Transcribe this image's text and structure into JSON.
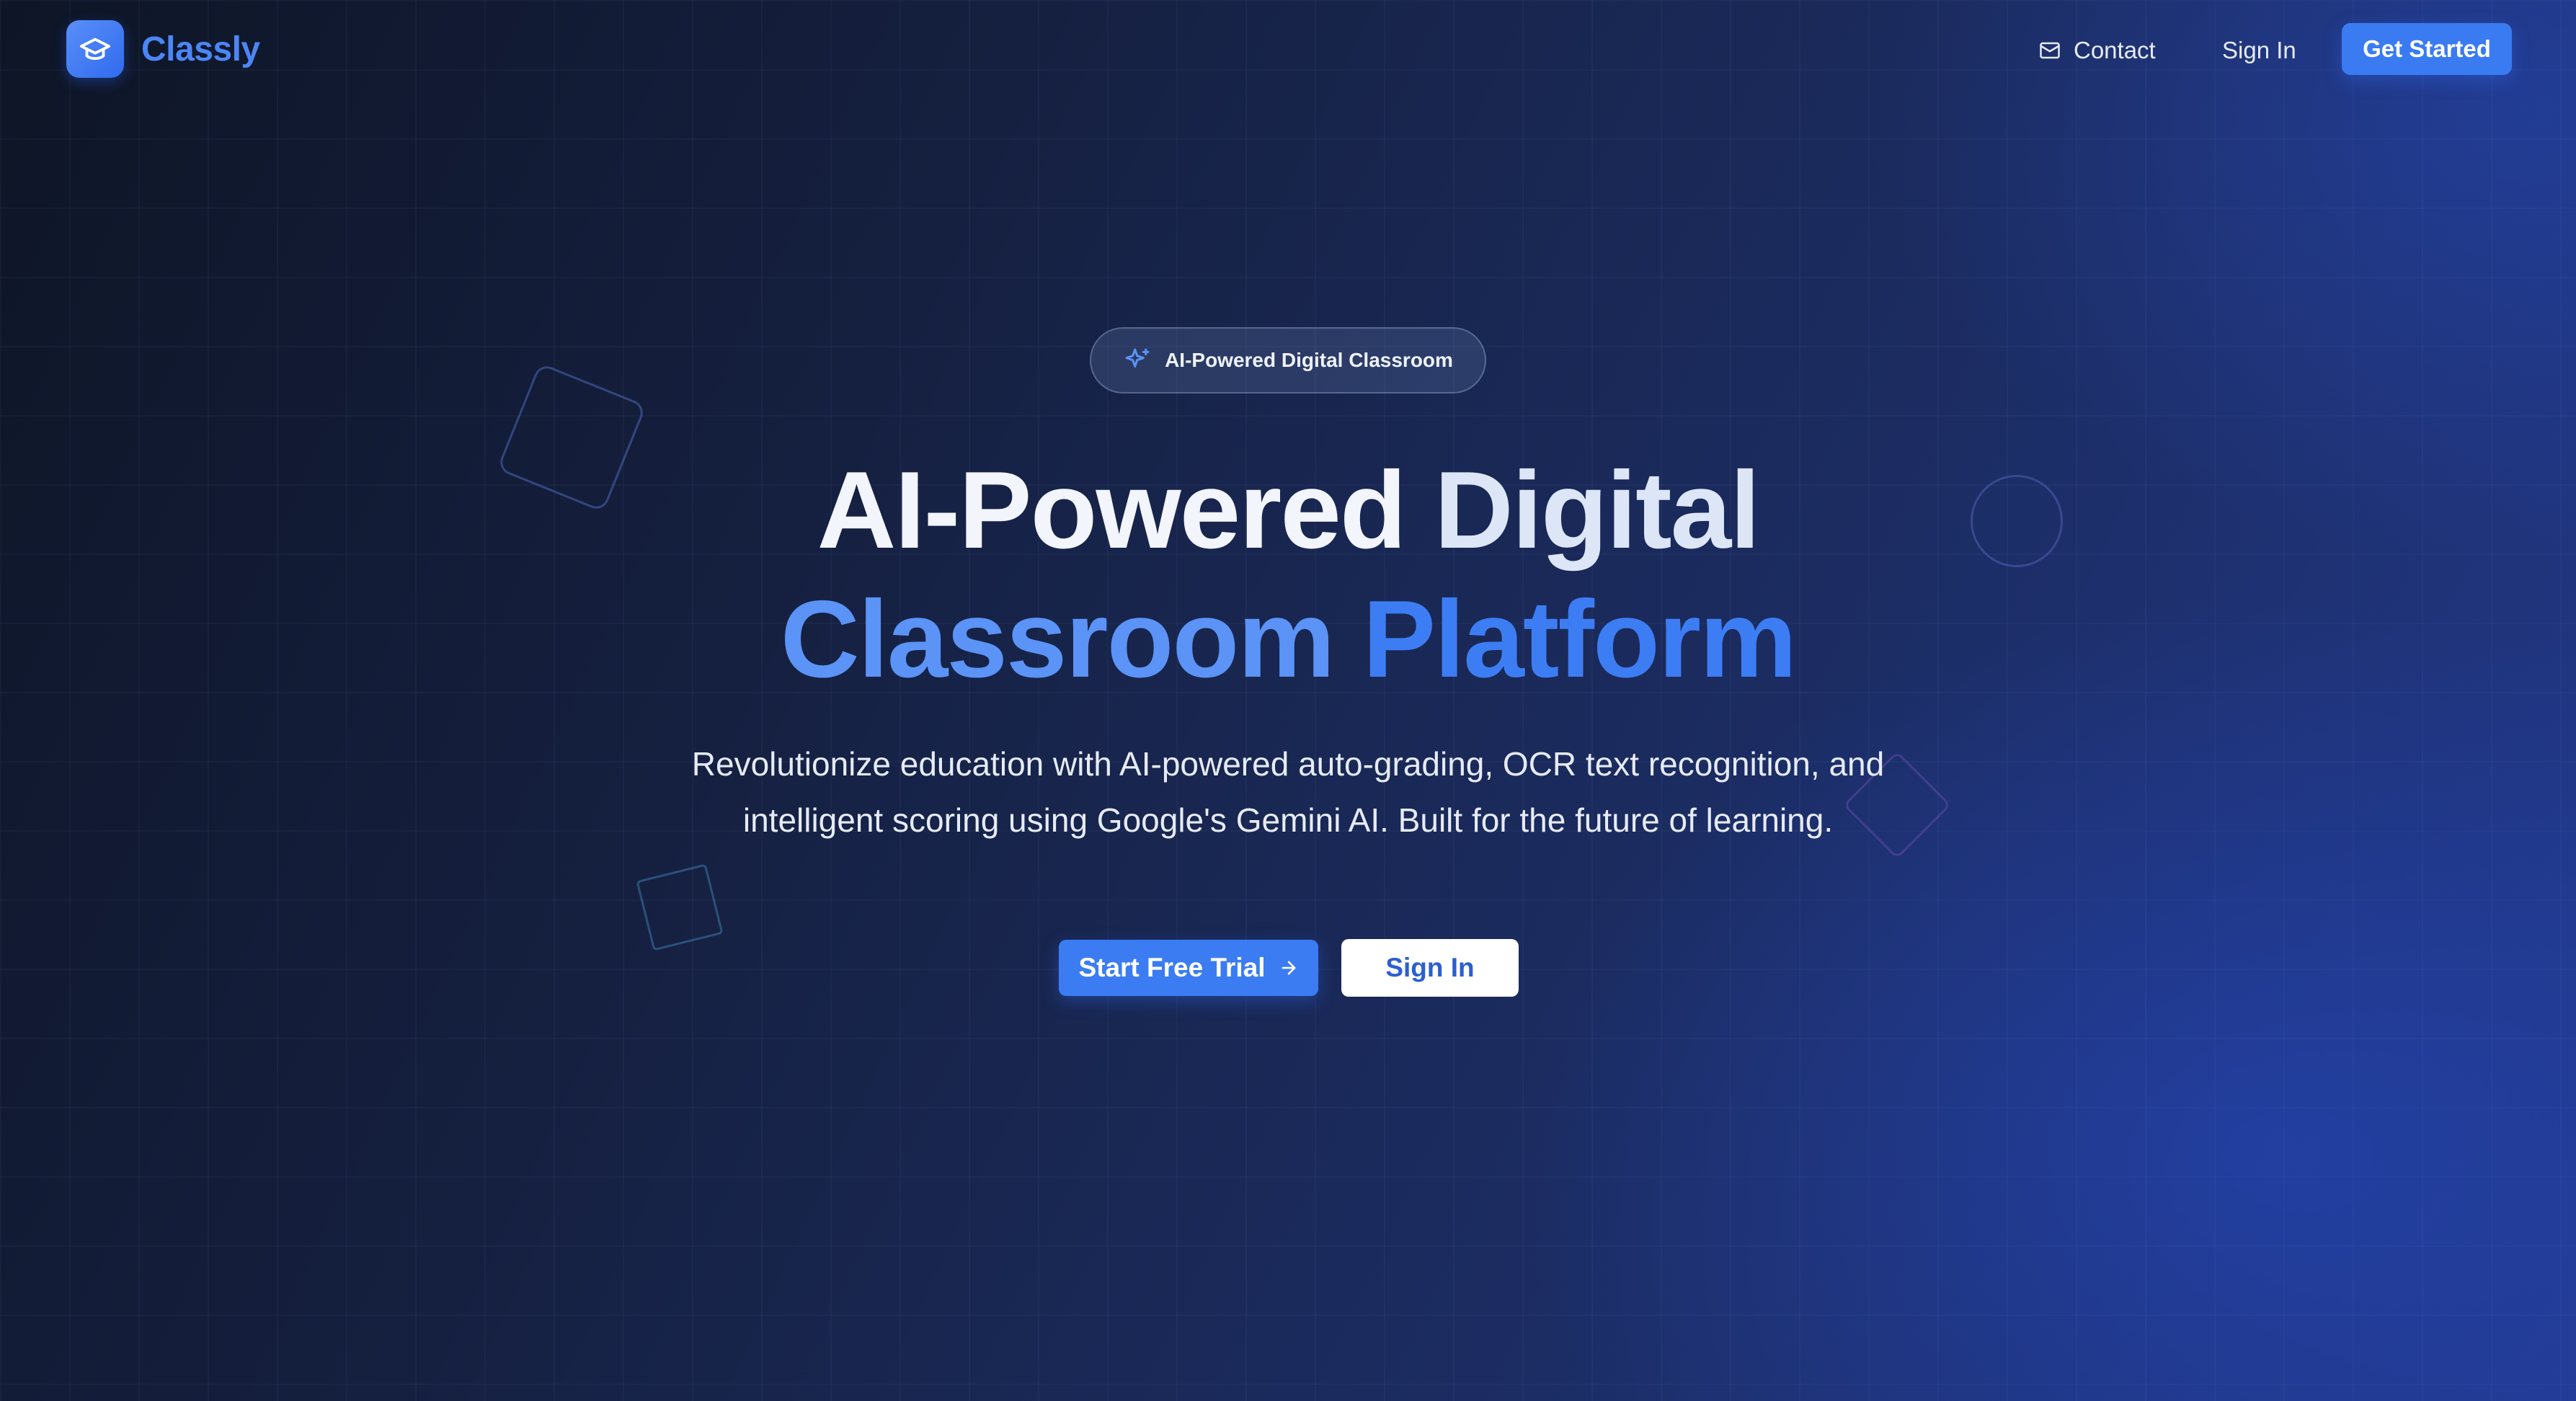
{
  "brand": {
    "name": "Classly",
    "logo_icon": "graduation-cap-icon"
  },
  "nav": {
    "contact_label": "Contact",
    "contact_icon": "mail-icon",
    "signin_label": "Sign In",
    "get_started_label": "Get Started"
  },
  "hero": {
    "badge_icon": "sparkles-icon",
    "badge_label": "AI-Powered Digital Classroom",
    "title_line1_part1": "AI-Powered",
    "title_line1_part2": "Digital",
    "title_line2_part1": "Classroom",
    "title_line2_part2": "Platform",
    "subtitle_line1": "Revolutionize education with AI-powered auto-grading, OCR text recognition, and",
    "subtitle_line2": "intelligent scoring using Google's Gemini AI. Built for the future of learning.",
    "primary_cta": "Start Free Trial",
    "primary_cta_icon": "arrow-right-icon",
    "secondary_cta": "Sign In"
  },
  "colors": {
    "accent": "#3b7cf2",
    "brand_text": "#4c86f5",
    "title_highlight": "#5b93f6",
    "background_dark": "#0e1526",
    "background_blue": "#22398c"
  }
}
